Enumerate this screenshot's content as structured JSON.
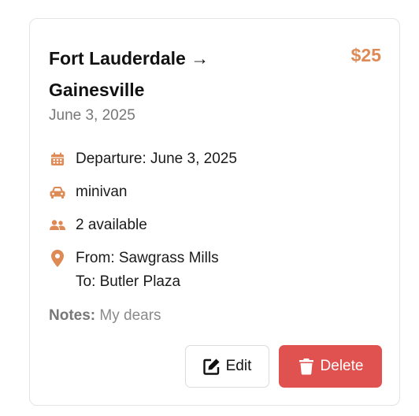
{
  "ride": {
    "route": "Fort Lauderdale → Gainesville",
    "price": "$25",
    "date": "June 3, 2025",
    "departure": "Departure: June 3, 2025",
    "vehicle": "minivan",
    "seats": "2 available",
    "from": "From: Sawgrass Mills",
    "to": "To: Butler Plaza",
    "notes_label": "Notes:",
    "notes_text": "My dears"
  },
  "actions": {
    "edit_label": "Edit",
    "delete_label": "Delete"
  },
  "icons": {
    "departure": "calendar-icon",
    "vehicle": "car-icon",
    "seats": "users-icon",
    "location": "map-pin-icon",
    "edit": "edit-icon",
    "delete": "trash-icon"
  },
  "colors": {
    "accent": "#dd8a55",
    "danger": "#e05250",
    "muted": "#777777"
  }
}
